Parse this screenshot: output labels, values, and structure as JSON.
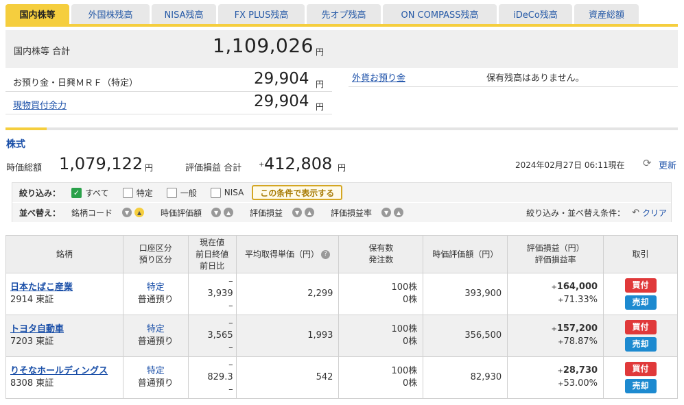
{
  "tabs": [
    {
      "label": "国内株等"
    },
    {
      "label": "外国株残高"
    },
    {
      "label": "NISA残高"
    },
    {
      "label": "FX PLUS残高"
    },
    {
      "label": "先オプ残高"
    },
    {
      "label": "ON COMPASS残高"
    },
    {
      "label": "iDeCo残高"
    },
    {
      "label": "資産総額"
    }
  ],
  "summary": {
    "total_label": "国内株等 合計",
    "total_value": "1,109,026",
    "yen": "円",
    "deposit_label": "お預り金・日興ＭＲＦ（特定）",
    "deposit_value": "29,904",
    "buying_power_label": "現物買付余力",
    "buying_power_value": "29,904",
    "fx_deposit_label": "外貨お預り金",
    "fx_deposit_status": "保有残高はありません。"
  },
  "stocks": {
    "title": "株式",
    "market_value_label": "時価総額",
    "market_value": "1,079,122",
    "pl_label": "評価損益 合計",
    "pl_sign": "+",
    "pl_value": "412,808",
    "timestamp": "2024年02月27日 06:11現在",
    "refresh_label": "更新"
  },
  "filter": {
    "label": "絞り込み：",
    "options": [
      {
        "label": "すべて",
        "checked": true
      },
      {
        "label": "特定",
        "checked": false
      },
      {
        "label": "一般",
        "checked": false
      },
      {
        "label": "NISA",
        "checked": false
      }
    ],
    "apply_label": "この条件で表示する",
    "sort_label": "並べ替え：",
    "sort_fields": [
      "銘柄コード",
      "時価評価額",
      "評価損益",
      "評価損益率"
    ],
    "conditions_label": "絞り込み・並べ替え条件：",
    "clear_label": "クリア"
  },
  "table": {
    "headers": {
      "name": "銘柄",
      "account": [
        "口座区分",
        "預り区分"
      ],
      "price": [
        "現在値",
        "前日終値",
        "前日比"
      ],
      "avg_cost": "平均取得単価（円）",
      "qty": [
        "保有数",
        "発注数"
      ],
      "market_value": "時価評価額（円）",
      "pl": [
        "評価損益（円）",
        "評価損益率"
      ],
      "trade": "取引"
    },
    "rows": [
      {
        "name": "日本たばこ産業",
        "code": "2914 東証",
        "account": "特定",
        "deposit": "普通預り",
        "cur": "–",
        "prev": "3,939",
        "chg": "–",
        "avg": "2,299",
        "qty": "100株",
        "order": "0株",
        "mv": "393,900",
        "pl": "164,000",
        "plr": "71.33%"
      },
      {
        "name": "トヨタ自動車",
        "code": "7203 東証",
        "account": "特定",
        "deposit": "普通預り",
        "cur": "–",
        "prev": "3,565",
        "chg": "–",
        "avg": "1,993",
        "qty": "100株",
        "order": "0株",
        "mv": "356,500",
        "pl": "157,200",
        "plr": "78.87%"
      },
      {
        "name": "りそなホールディングス",
        "code": "8308 東証",
        "account": "特定",
        "deposit": "普通預り",
        "cur": "–",
        "prev": "829.3",
        "chg": "–",
        "avg": "542",
        "qty": "100株",
        "order": "0株",
        "mv": "82,930",
        "pl": "28,730",
        "plr": "53.00%"
      }
    ],
    "buy_label": "買付",
    "sell_label": "売却",
    "plus": "+"
  }
}
